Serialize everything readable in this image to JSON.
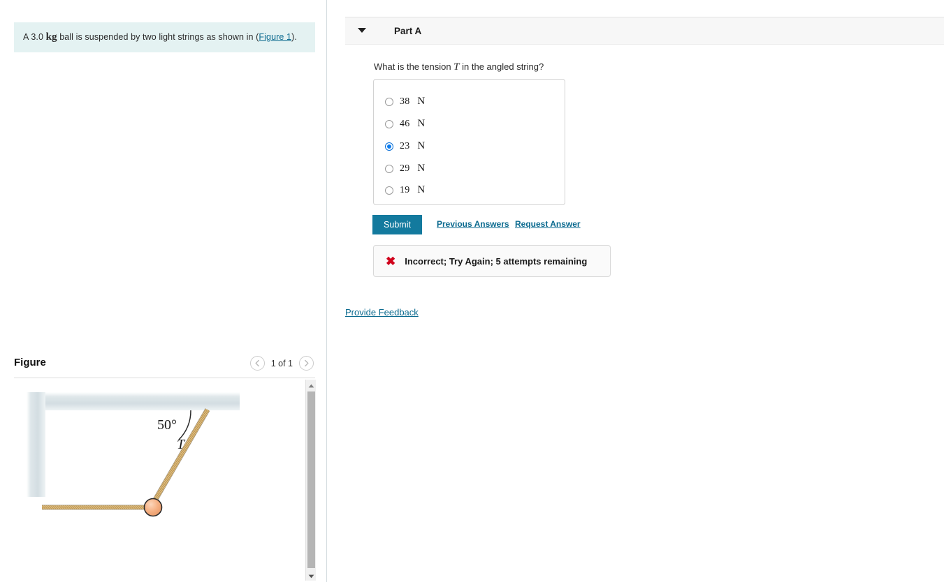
{
  "left": {
    "problem": {
      "prefix": "A 3.0 ",
      "mass_unit": "kg",
      "middle": " ball is suspended by two light strings as shown in (",
      "figure_link": "Figure 1",
      "suffix": ")."
    },
    "figure": {
      "title": "Figure",
      "counter": "1 of 1",
      "prev_icon": "chevron-left-icon",
      "next_icon": "chevron-right-icon",
      "angle_label": "50°",
      "tension_label": "T"
    },
    "scrollbar": {
      "up_icon": "triangle-up-icon",
      "down_icon": "triangle-down-icon"
    }
  },
  "right": {
    "part": {
      "caret_icon": "caret-down-icon",
      "label": "Part A"
    },
    "question": {
      "before": "What is the tension ",
      "symbol": "T",
      "after": " in the angled string?"
    },
    "options": [
      {
        "value": "38",
        "unit": "N",
        "selected": false
      },
      {
        "value": "46",
        "unit": "N",
        "selected": false
      },
      {
        "value": "23",
        "unit": "N",
        "selected": true
      },
      {
        "value": "29",
        "unit": "N",
        "selected": false
      },
      {
        "value": "19",
        "unit": "N",
        "selected": false
      }
    ],
    "actions": {
      "submit_label": "Submit",
      "previous_answers_label": "Previous Answers",
      "request_answer_label": "Request Answer"
    },
    "feedback": {
      "icon": "x-mark-icon",
      "message": "Incorrect; Try Again; 5 attempts remaining"
    },
    "provide_feedback_label": "Provide Feedback"
  },
  "colors": {
    "accent": "#137a9e",
    "link": "#0b6a8f",
    "problem_bg": "#e4f2f2",
    "error": "#d0021b",
    "radio_selected": "#0a7cf0",
    "rope": "#c9a15a",
    "ball": "#f4b183",
    "wall": "#d7e1e6"
  }
}
